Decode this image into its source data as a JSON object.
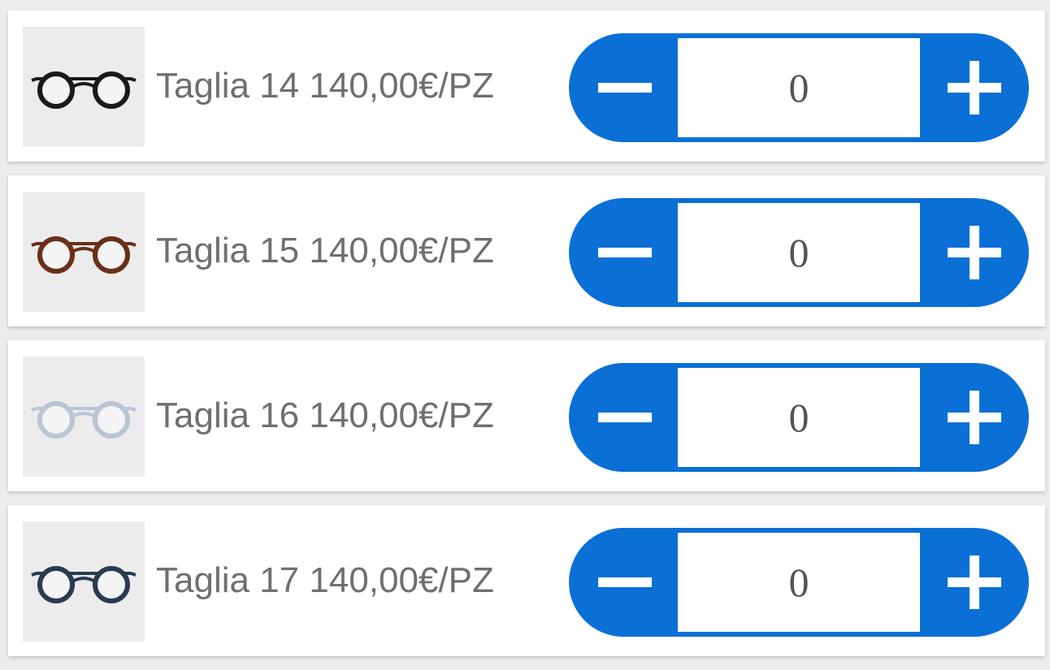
{
  "products": [
    {
      "label": "Taglia 14 140,00€/PZ",
      "quantity": "0",
      "thumbnail_icon": "glasses-black-icon",
      "frame_color": "#1a1a1a"
    },
    {
      "label": "Taglia 15 140,00€/PZ",
      "quantity": "0",
      "thumbnail_icon": "glasses-tortoise-icon",
      "frame_color": "#6a2f1a"
    },
    {
      "label": "Taglia 16 140,00€/PZ",
      "quantity": "0",
      "thumbnail_icon": "glasses-clear-icon",
      "frame_color": "#b9c4d4"
    },
    {
      "label": "Taglia 17 140,00€/PZ",
      "quantity": "0",
      "thumbnail_icon": "glasses-navy-icon",
      "frame_color": "#2a3a52"
    }
  ],
  "stepper": {
    "accent_color": "#0a70d5",
    "minus_icon": "minus-icon",
    "plus_icon": "plus-icon"
  }
}
